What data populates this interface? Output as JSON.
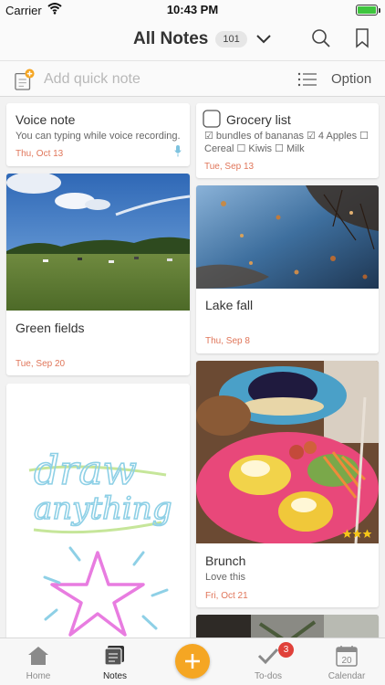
{
  "status_bar": {
    "carrier": "Carrier",
    "time": "10:43 PM",
    "battery_level": 1.0
  },
  "header": {
    "title": "All Notes",
    "note_count": "101"
  },
  "quick_note": {
    "placeholder": "Add quick note",
    "option_label": "Option"
  },
  "notes": {
    "voice": {
      "title": "Voice note",
      "body": "You can typing while voice recording.",
      "date": "Thu, Oct 13"
    },
    "grocery": {
      "title": "Grocery list",
      "line1": "☑ bundles of bananas  ☑ 4 Apples  ☐",
      "line2": "Cereal  ☐ Kiwis  ☐ Milk",
      "date": "Tue, Sep 13"
    },
    "green": {
      "title": "Green fields",
      "date": "Tue, Sep 20"
    },
    "lake": {
      "title": "Lake fall",
      "date": "Thu, Sep 8"
    },
    "drawing": {
      "line1": "draw",
      "line2": "anything"
    },
    "brunch": {
      "title": "Brunch",
      "body": "Love this",
      "date": "Fri, Oct 21",
      "rating": 3
    }
  },
  "tabbar": {
    "home": "Home",
    "notes": "Notes",
    "todos": "To-dos",
    "todos_badge": "3",
    "calendar": "Calendar",
    "calendar_day": "20"
  },
  "colors": {
    "accent": "#f5a623",
    "date": "#e0765a",
    "badge": "#e0413a",
    "battery": "#3ec53e"
  },
  "icons": [
    "wifi-icon",
    "chevron-down-icon",
    "search-icon",
    "bookmark-icon",
    "note-add-icon",
    "list-icon",
    "microphone-icon",
    "checkbox-icon",
    "star-icon",
    "home-icon",
    "notes-icon",
    "plus-icon",
    "check-icon",
    "calendar-icon"
  ]
}
